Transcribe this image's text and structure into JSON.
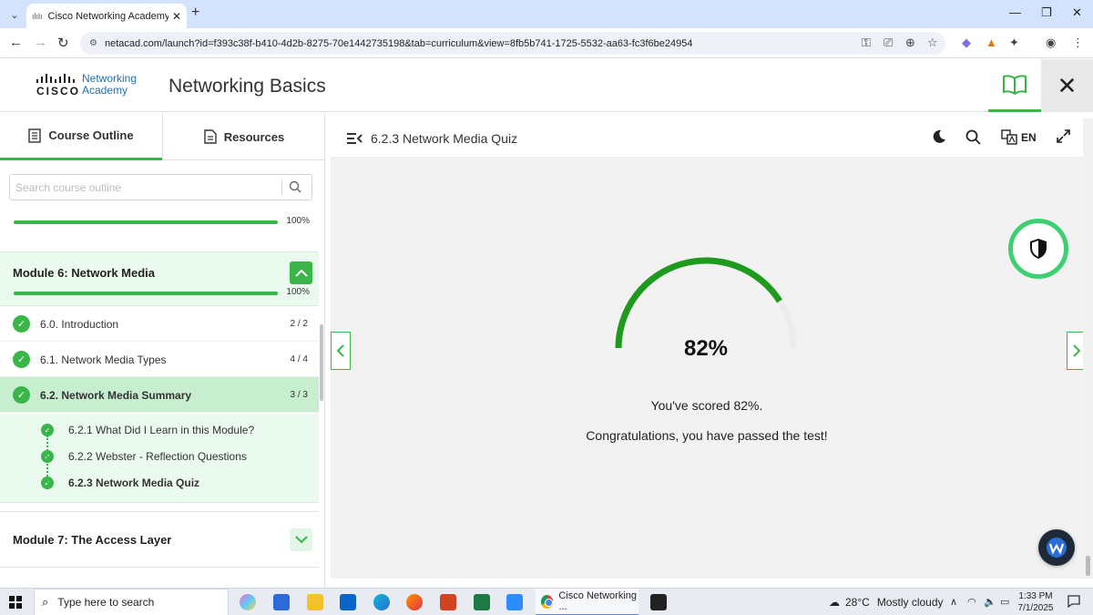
{
  "browser": {
    "tab_title": "Cisco Networking Academy: Co",
    "url": "netacad.com/launch?id=f393c38f-b410-4d2b-8275-70e1442735198&tab=curriculum&view=8fb5b741-1725-5532-aa63-fc3f6be24954"
  },
  "header": {
    "brand_word": "CISCO",
    "brand_line1": "Networking",
    "brand_line2": "Academy",
    "course_title": "Networking Basics"
  },
  "sidebar": {
    "tab_outline": "Course Outline",
    "tab_resources": "Resources",
    "search_placeholder": "Search course outline",
    "course_progress": "100%",
    "module6": {
      "title": "Module 6: Network Media",
      "progress": "100%",
      "lessons": [
        {
          "label": "6.0. Introduction",
          "count": "2 / 2"
        },
        {
          "label": "6.1. Network Media Types",
          "count": "4 / 4"
        },
        {
          "label": "6.2. Network Media Summary",
          "count": "3 / 3"
        }
      ],
      "subitems": [
        {
          "label": "6.2.1 What Did I Learn in this Module?"
        },
        {
          "label": "6.2.2 Webster - Reflection Questions"
        },
        {
          "label": "6.2.3 Network Media Quiz"
        }
      ]
    },
    "module7": {
      "title": "Module 7: The Access Layer"
    }
  },
  "main": {
    "topic_title": "6.2.3 Network Media Quiz",
    "lang": "EN",
    "score_value": 82,
    "score_percent": "82%",
    "score_message": "You've scored 82%.",
    "congrats": "Congratulations, you have passed the test!"
  },
  "taskbar": {
    "search_placeholder": "Type here to search",
    "chrome_label": "Cisco Networking ...",
    "weather_temp": "28°C",
    "weather_desc": "Mostly cloudy",
    "time": "1:33 PM",
    "date": "7/1/2025"
  },
  "colors": {
    "accent_green": "#3ab54a",
    "score_arc": "#1e9a1e",
    "header_tab_bg": "#d3e3fd"
  }
}
